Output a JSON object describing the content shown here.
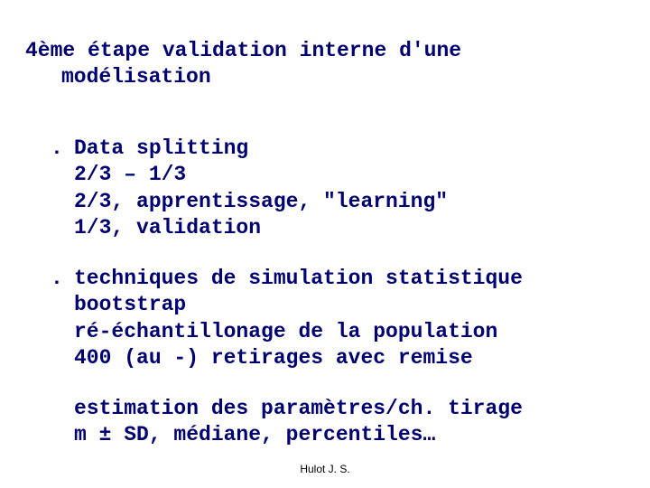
{
  "heading": {
    "line1": "4ème étape validation interne d'une",
    "line2": "modélisation"
  },
  "items": [
    {
      "marker": ".",
      "lines": [
        "Data splitting",
        "2/3 – 1/3",
        "2/3, apprentissage, \"learning\"",
        "1/3,  validation"
      ]
    },
    {
      "marker": ".",
      "lines": [
        "techniques de simulation statistique",
        "bootstrap",
        "ré-échantillonage de la population",
        "400 (au -) retirages avec remise",
        "",
        "estimation des paramètres/ch. tirage",
        "m ± SD, médiane, percentiles…"
      ]
    }
  ],
  "footer": "Hulot J. S."
}
